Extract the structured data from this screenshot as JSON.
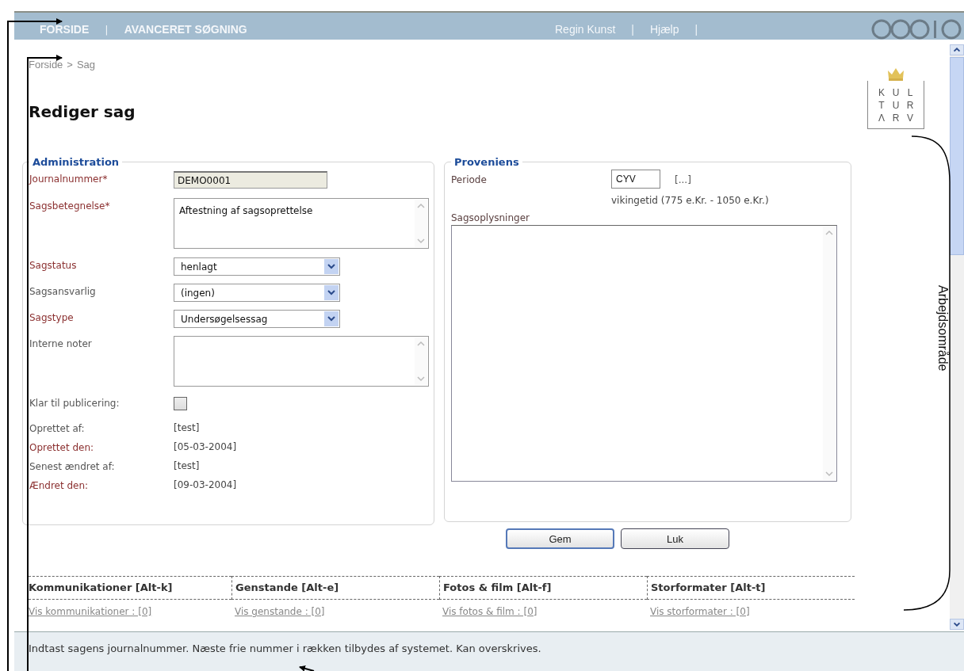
{
  "nav": {
    "left": [
      {
        "label": "FORSIDE",
        "selected": false
      },
      {
        "label": "AVANCERET SØGNING",
        "selected": false
      }
    ],
    "separator": "|",
    "right": [
      "Regin Kunst",
      "Hjælp"
    ]
  },
  "breadcrumb": {
    "link": "Forside",
    "separator": ">",
    "current": "Sag"
  },
  "title": "Rediger sag",
  "logo": {
    "letters": [
      "K",
      "U",
      "L",
      "T",
      "U",
      "R",
      "Λ",
      "R",
      "V"
    ]
  },
  "administration": {
    "legend": "Administration",
    "rows": [
      {
        "label": "Journalnummer*",
        "color": "#8b3030",
        "kind": "input",
        "value": "DEMO0001"
      },
      {
        "label": "Sagsbetegnelse*",
        "color": "#8b3030",
        "kind": "textarea",
        "value": "Aftestning af sagsoprettelse"
      },
      {
        "label": "Sagstatus",
        "color": "#8b3030",
        "kind": "select",
        "value": "henlagt"
      },
      {
        "label": "Sagsansvarlig",
        "color": "#555555",
        "kind": "select",
        "value": "(ingen)"
      },
      {
        "label": "Sagstype",
        "color": "#8b3030",
        "kind": "select",
        "value": "Undersøgelsessag"
      },
      {
        "label": "Interne noter",
        "color": "#555555",
        "kind": "textarea"
      },
      {
        "label": "Klar til publicering:",
        "color": "#555555",
        "kind": "checkbox",
        "checked": false
      },
      {
        "label": "Oprettet af:",
        "color": "#555555",
        "kind": "readonly",
        "value": "[test]"
      },
      {
        "label": "Oprettet den:",
        "color": "#8b3030",
        "kind": "readonly",
        "value": "[05-03-2004]"
      },
      {
        "label": "Senest ændret af:",
        "color": "#555555",
        "kind": "readonly",
        "value": "[test]"
      },
      {
        "label": "Ændret den:",
        "color": "#8b3030",
        "kind": "readonly",
        "value": "[09-03-2004]"
      }
    ]
  },
  "proveniens": {
    "legend": "Proveniens",
    "periode_label": "Periode",
    "periode_value": "CYV",
    "picker_link": "[...]",
    "periode_description": "vikingetid (775 e.Kr. - 1050 e.Kr.)",
    "info_label": "Sagsoplysninger"
  },
  "buttons": [
    "Gem",
    "Luk"
  ],
  "sections": [
    {
      "title": "Kommunikationer [Alt-k]",
      "link": "Vis kommunikationer : [0]"
    },
    {
      "title": "Genstande [Alt-e]",
      "link": "Vis genstande : [0]"
    },
    {
      "title": "Fotos & film [Alt-f]",
      "link": "Vis fotos & film : [0]"
    },
    {
      "title": "Storformater [Alt-t]",
      "link": "Vis storformater : [0]"
    }
  ],
  "status_bar": "Indtast sagens journalnummer. Næste frie nummer i rækken tilbydes af systemet. Kan overskrives.",
  "annotation_label": "Arbejdsområde"
}
